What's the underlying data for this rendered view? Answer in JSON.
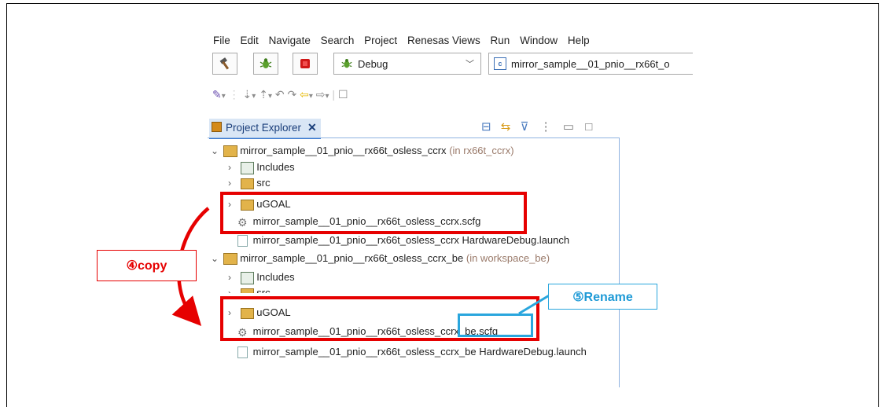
{
  "menu": [
    "File",
    "Edit",
    "Navigate",
    "Search",
    "Project",
    "Renesas Views",
    "Run",
    "Window",
    "Help"
  ],
  "toolbar": {
    "config_value": "Debug",
    "launch_value": "mirror_sample__01_pnio__rx66t_o"
  },
  "panel": {
    "title": "Project Explorer",
    "close": "✕"
  },
  "tree": {
    "project1": {
      "name": "mirror_sample__01_pnio__rx66t_osless_ccrx",
      "location": "(in rx66t_ccrx)"
    },
    "p1_includes": "Includes",
    "p1_src": "src",
    "p1_ugoal": "uGOAL",
    "p1_scfg": "mirror_sample__01_pnio__rx66t_osless_ccrx.scfg",
    "p1_launch": "mirror_sample__01_pnio__rx66t_osless_ccrx HardwareDebug.launch",
    "project2": {
      "name": "mirror_sample__01_pnio__rx66t_osless_ccrx_be",
      "location": "(in workspace_be)"
    },
    "p2_includes": "Includes",
    "p2_src": "src",
    "p2_ugoal": "uGOAL",
    "p2_scfg": "mirror_sample__01_pnio__rx66t_osless_ccrx_be.scfg",
    "p2_launch": "mirror_sample__01_pnio__rx66t_osless_ccrx_be HardwareDebug.launch"
  },
  "annotations": {
    "copy": "④copy",
    "rename": "⑤Rename",
    "red": "#e60000",
    "blue": "#2aa6dd"
  }
}
